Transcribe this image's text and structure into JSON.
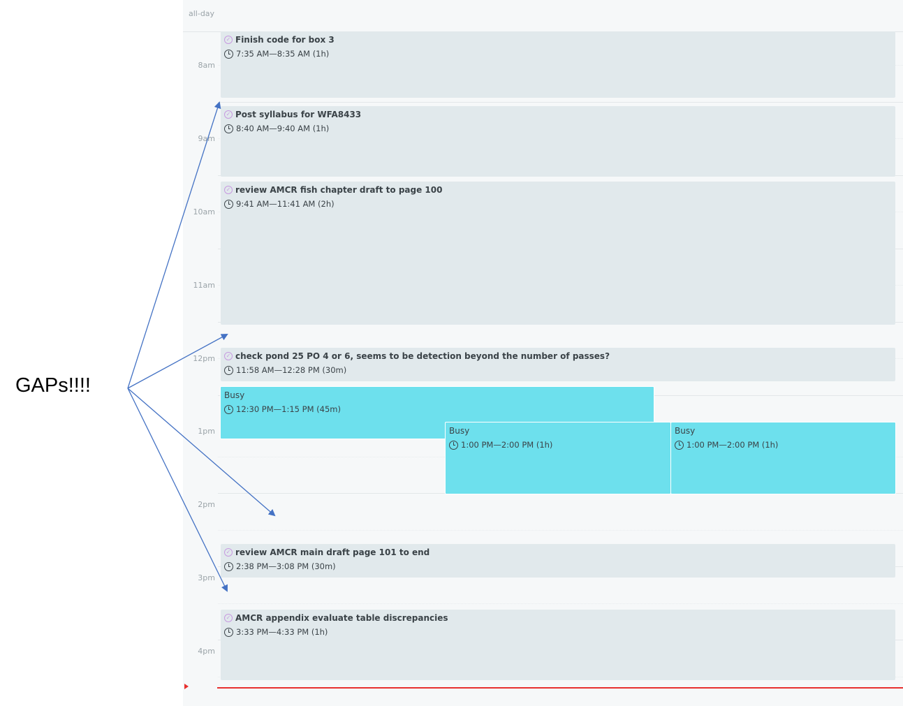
{
  "calendar": {
    "allday_label": "all-day",
    "hours": [
      "8am",
      "9am",
      "10am",
      "11am",
      "12pm",
      "1pm",
      "2pm",
      "3pm",
      "4pm"
    ],
    "events": [
      {
        "title": "Finish code for box 3",
        "time": "7:35 AM—8:35 AM (1h)",
        "type": "task"
      },
      {
        "title": "Post syllabus for WFA8433",
        "time": "8:40 AM—9:40 AM (1h)",
        "type": "task"
      },
      {
        "title": "review AMCR fish chapter draft to page 100",
        "time": "9:41 AM—11:41 AM (2h)",
        "type": "task"
      },
      {
        "title": "check pond 25 PO 4 or 6, seems to be detection beyond the number of passes?",
        "time": "11:58 AM—12:28 PM (30m)",
        "type": "task"
      },
      {
        "title": "Busy",
        "time": "12:30 PM—1:15 PM (45m)",
        "type": "busy"
      },
      {
        "title": "Busy",
        "time": "1:00 PM—2:00 PM (1h)",
        "type": "busy"
      },
      {
        "title": "Busy",
        "time": "1:00 PM—2:00 PM (1h)",
        "type": "busy"
      },
      {
        "title": "review AMCR main draft page 101 to end",
        "time": "2:38 PM—3:08 PM (30m)",
        "type": "task"
      },
      {
        "title": "AMCR appendix evaluate table discrepancies",
        "time": "3:33 PM—4:33 PM (1h)",
        "type": "task"
      }
    ]
  },
  "annotation": {
    "text": "GAPs!!!!"
  },
  "colors": {
    "task_bg": "#e1e9ec",
    "busy_bg": "#6de0ed",
    "now_line": "#e8302e",
    "arrow": "#4472c4",
    "check": "#c79ae0"
  }
}
